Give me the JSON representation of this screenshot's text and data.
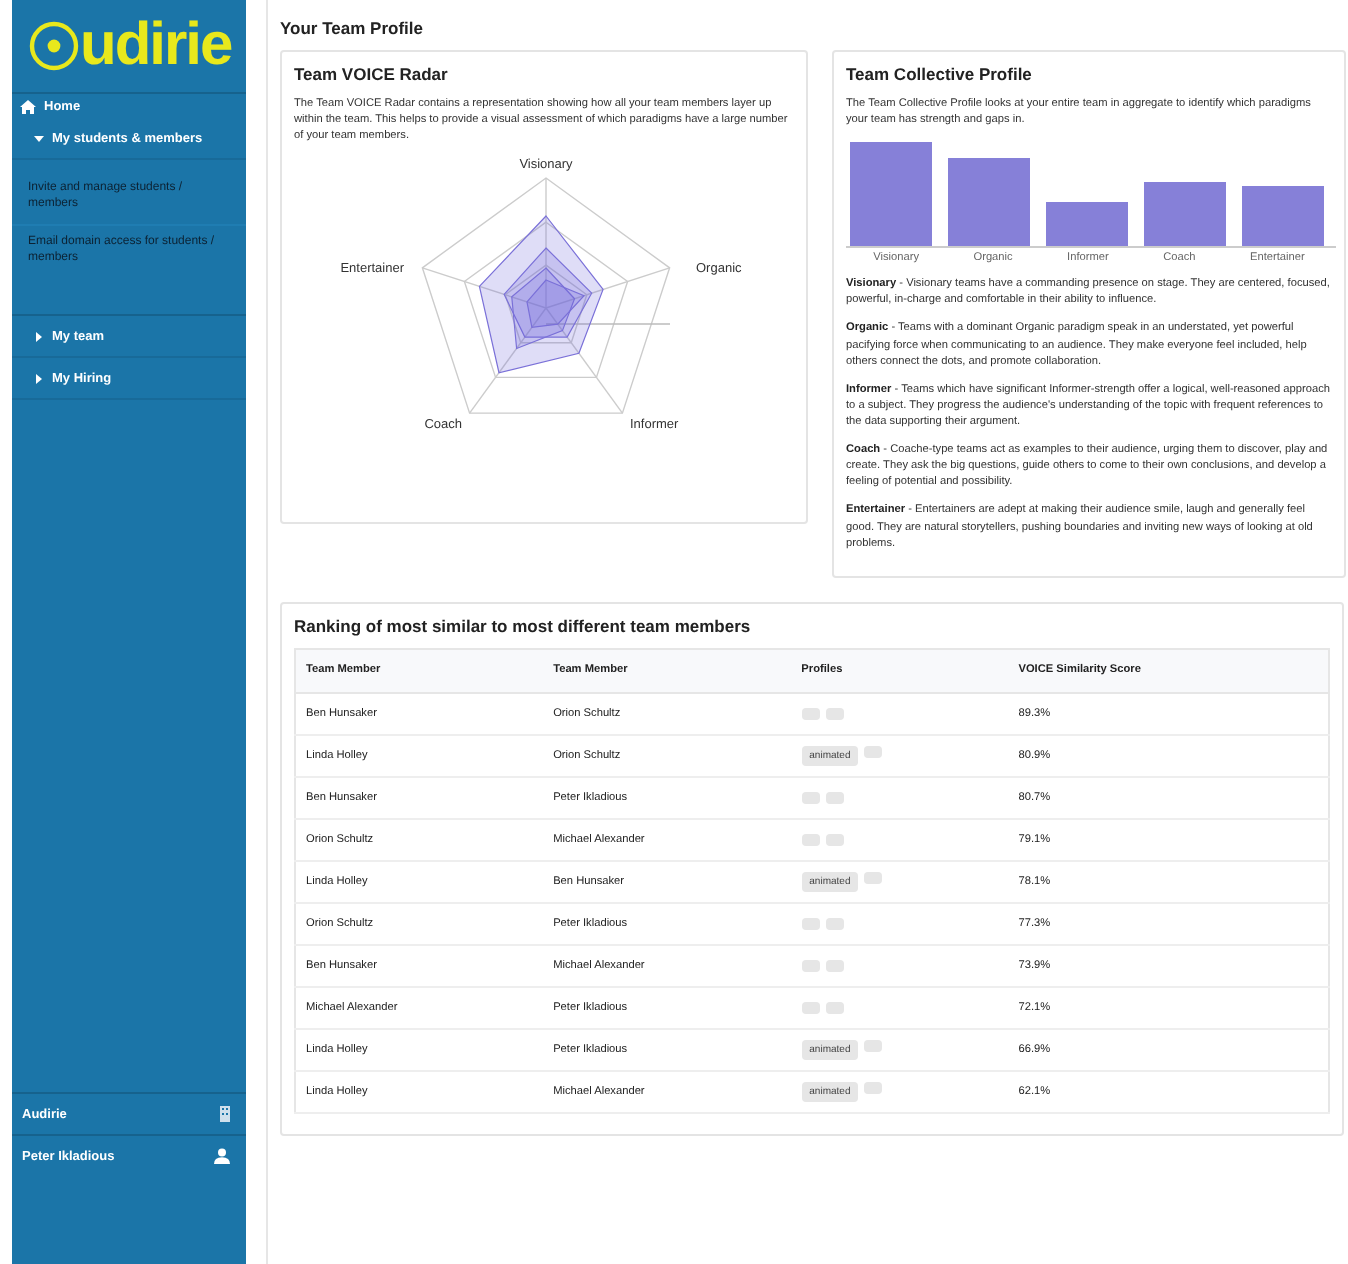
{
  "sidebar": {
    "logo_text": "udirie",
    "items": [
      {
        "kind": "home",
        "label": "Home"
      },
      {
        "kind": "group",
        "label": "My students & members",
        "expanded": true,
        "children": [
          {
            "label": "Invite and manage students / members"
          },
          {
            "label": "Email domain access for students / members"
          }
        ]
      },
      {
        "kind": "group",
        "label": "My team",
        "expanded": false
      },
      {
        "kind": "group",
        "label": "My Hiring",
        "expanded": false
      }
    ],
    "footer": [
      {
        "kind": "org",
        "label": "Audirie"
      },
      {
        "kind": "user",
        "label": "Peter Ikladious"
      }
    ]
  },
  "page_title": "Your Team Profile",
  "radar": {
    "title": "Team VOICE Radar",
    "description": "The Team VOICE Radar contains a representation showing how all your team members layer up within the team. This helps to provide a visual assessment of which paradigms have a large number of your team members.",
    "axes": [
      "Visionary",
      "Organic",
      "Informer",
      "Coach",
      "Entertainer"
    ]
  },
  "collective": {
    "title": "Team Collective Profile",
    "description": "The Team Collective Profile looks at your entire team in aggregate to identify which paradigms your team has strength and gaps in.",
    "bar_labels": [
      "Visionary",
      "Organic",
      "Informer",
      "Coach",
      "Entertainer"
    ],
    "definitions": [
      {
        "term": "Visionary",
        "text": "- Visionary teams have a commanding presence on stage. They are centered, focused, powerful, in-charge and comfortable in their ability to influence."
      },
      {
        "term": "Organic",
        "text": "- Teams with a dominant Organic paradigm speak in an understated, yet powerful pacifying force when communicating to an audience. They make everyone feel included, help others connect the dots, and promote collaboration."
      },
      {
        "term": "Informer",
        "text": "- Teams which have significant Informer-strength offer a logical, well-reasoned approach to a subject. They progress the audience's understanding of the topic with frequent references to the data supporting their argument."
      },
      {
        "term": "Coach",
        "text": "- Coache-type teams act as examples to their audience, urging them to discover, play and create. They ask the big questions, guide others to come to their own conclusions, and develop a feeling of potential and possibility."
      },
      {
        "term": "Entertainer",
        "text": "- Entertainers are adept at making their audience smile, laugh and generally feel good. They are natural storytellers, pushing boundaries and inviting new ways of looking at old problems."
      }
    ]
  },
  "ranking": {
    "title": "Ranking of most similar to most different team members",
    "columns": [
      "Team Member",
      "Team Member",
      "Profiles",
      "VOICE Similarity Score"
    ],
    "rows": [
      {
        "member_a": "Ben Hunsaker",
        "member_b": "Orion Schultz",
        "profiles": [
          {
            "kind": "blank"
          },
          {
            "kind": "blank"
          }
        ],
        "score": "89.3%"
      },
      {
        "member_a": "Linda Holley",
        "member_b": "Orion Schultz",
        "profiles": [
          {
            "kind": "tag",
            "label": "animated"
          },
          {
            "kind": "blank"
          }
        ],
        "score": "80.9%"
      },
      {
        "member_a": "Ben Hunsaker",
        "member_b": "Peter Ikladious",
        "profiles": [
          {
            "kind": "blank"
          },
          {
            "kind": "blank"
          }
        ],
        "score": "80.7%"
      },
      {
        "member_a": "Orion Schultz",
        "member_b": "Michael Alexander",
        "profiles": [
          {
            "kind": "blank"
          },
          {
            "kind": "blank"
          }
        ],
        "score": "79.1%"
      },
      {
        "member_a": "Linda Holley",
        "member_b": "Ben Hunsaker",
        "profiles": [
          {
            "kind": "tag",
            "label": "animated"
          },
          {
            "kind": "blank"
          }
        ],
        "score": "78.1%"
      },
      {
        "member_a": "Orion Schultz",
        "member_b": "Peter Ikladious",
        "profiles": [
          {
            "kind": "blank"
          },
          {
            "kind": "blank"
          }
        ],
        "score": "77.3%"
      },
      {
        "member_a": "Ben Hunsaker",
        "member_b": "Michael Alexander",
        "profiles": [
          {
            "kind": "blank"
          },
          {
            "kind": "blank"
          }
        ],
        "score": "73.9%"
      },
      {
        "member_a": "Michael Alexander",
        "member_b": "Peter Ikladious",
        "profiles": [
          {
            "kind": "blank"
          },
          {
            "kind": "blank"
          }
        ],
        "score": "72.1%"
      },
      {
        "member_a": "Linda Holley",
        "member_b": "Peter Ikladious",
        "profiles": [
          {
            "kind": "tag",
            "label": "animated"
          },
          {
            "kind": "blank"
          }
        ],
        "score": "66.9%"
      },
      {
        "member_a": "Linda Holley",
        "member_b": "Michael Alexander",
        "profiles": [
          {
            "kind": "tag",
            "label": "animated"
          },
          {
            "kind": "blank"
          }
        ],
        "score": "62.1%"
      }
    ]
  }
}
